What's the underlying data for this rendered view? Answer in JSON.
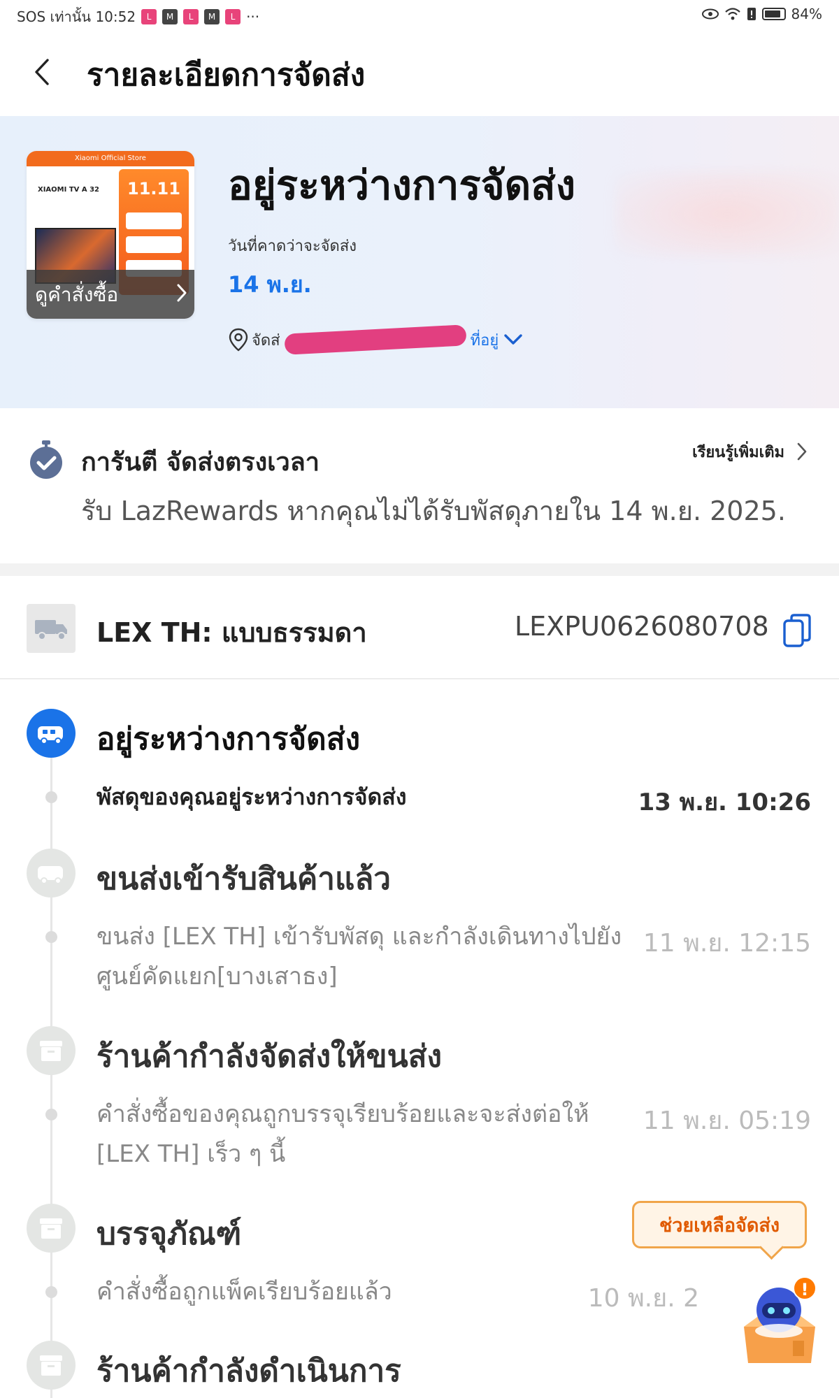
{
  "status_bar": {
    "left_text": "SOS เท่านั้น 10:52",
    "notification_icons": [
      "lazada-icon",
      "mail-icon",
      "lazada-icon",
      "mail-icon",
      "lazada-icon"
    ],
    "more": "···",
    "battery": "84%"
  },
  "header": {
    "title": "รายละเอียดการจัดส่ง"
  },
  "hero": {
    "status_title": "อยู่ระหว่างการจัดส่ง",
    "eta_label": "วันที่คาดว่าจะจัดส่ง",
    "eta_date": "14 พ.ย.",
    "address_prefix": "จัดส่",
    "address_link": "ที่อยู่",
    "product_image": {
      "store_banner": "Xiaomi Official Store",
      "brand": "XIAOMI TV A 32",
      "promo": "11.11"
    },
    "view_order_label": "ดูคำสั่งซื้อ"
  },
  "guarantee": {
    "title": "การันตี จัดส่งตรงเวลา",
    "learn_more": "เรียนรู้เพิ่มเติม",
    "description": "รับ LazRewards หากคุณไม่ได้รับพัสดุภายใน 14 พ.ย. 2025."
  },
  "carrier": {
    "name": "LEX TH: แบบธรรมดา",
    "tracking_number": "LEXPU0626080708"
  },
  "timeline": [
    {
      "title": "อยู่ระหว่างการจัดส่ง",
      "description": "พัสดุของคุณอยู่ระหว่างการจัดส่ง",
      "time": "13 พ.ย. 10:26",
      "active": true
    },
    {
      "title": "ขนส่งเข้ารับสินค้าแล้ว",
      "description": "ขนส่ง [LEX TH] เข้ารับพัสดุ และกำลังเดินทางไปยังศูนย์คัดแยก[บางเสาธง]",
      "time": "11 พ.ย. 12:15",
      "active": false
    },
    {
      "title": "ร้านค้ากำลังจัดส่งให้ขนส่ง",
      "description": "คำสั่งซื้อของคุณถูกบรรจุเรียบร้อยและจะส่งต่อให้ [LEX TH] เร็ว ๆ นี้",
      "time": "11 พ.ย. 05:19",
      "active": false
    },
    {
      "title": "บรรจุภัณฑ์",
      "description": "คำสั่งซื้อถูกแพ็คเรียบร้อยแล้ว",
      "time": "10 พ.ย. 2",
      "active": false
    },
    {
      "title": "ร้านค้ากำลังดำเนินการ",
      "description": "",
      "time": "",
      "active": false
    }
  ],
  "help_bubble": {
    "label": "ช่วยเหลือจัดส่ง"
  },
  "assistant": {
    "badge": "!"
  },
  "colors": {
    "accent_blue": "#1a73e8",
    "help_orange": "#e05a00",
    "redaction": "#e23f80"
  }
}
